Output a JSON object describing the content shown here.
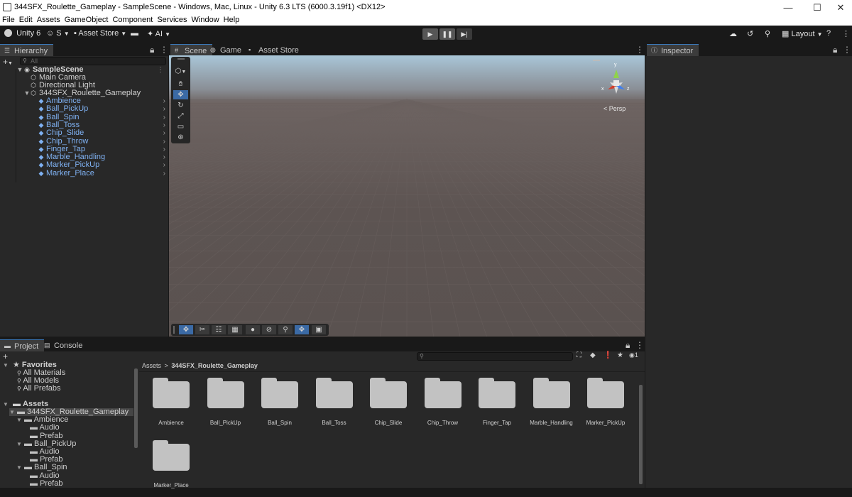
{
  "window": {
    "title": "344SFX_Roulette_Gameplay - SampleScene - Windows, Mac, Linux - Unity 6.3 LTS (6000.3.19f1) <DX12>",
    "minimize": "—",
    "maximize": "☐",
    "close": "✕"
  },
  "menu": [
    "File",
    "Edit",
    "Assets",
    "GameObject",
    "Component",
    "Services",
    "Window",
    "Help"
  ],
  "toolbar": {
    "unity": "Unity 6",
    "account": "S",
    "asset_store": "Asset Store",
    "ai": "AI",
    "layout": "Layout"
  },
  "hierarchy": {
    "tab": "Hierarchy",
    "search_placeholder": "All",
    "scene": "SampleScene",
    "items": [
      {
        "label": "Main Camera"
      },
      {
        "label": "Directional Light"
      },
      {
        "label": "344SFX_Roulette_Gameplay"
      }
    ],
    "prefabs": [
      "Ambience",
      "Ball_PickUp",
      "Ball_Spin",
      "Ball_Toss",
      "Chip_Slide",
      "Chip_Throw",
      "Finger_Tap",
      "Marble_Handling",
      "Marker_PickUp",
      "Marker_Place"
    ]
  },
  "scene_tabs": {
    "scene": "Scene",
    "game": "Game",
    "asset_store": "Asset Store"
  },
  "scene": {
    "persp": "< Persp",
    "gizmo_y": "y",
    "gizmo_x": "x",
    "gizmo_z": "z"
  },
  "inspector": {
    "tab": "Inspector"
  },
  "project": {
    "tab_project": "Project",
    "tab_console": "Console",
    "breadcrumb_root": "Assets",
    "breadcrumb_sep": ">",
    "breadcrumb_current": "344SFX_Roulette_Gameplay",
    "hidden_count": "1",
    "favorites": "Favorites",
    "favorite_items": [
      "All Materials",
      "All Models",
      "All Prefabs"
    ],
    "assets": "Assets",
    "tree": [
      {
        "label": "344SFX_Roulette_Gameplay",
        "depth": 1
      },
      {
        "label": "Ambience",
        "depth": 2
      },
      {
        "label": "Audio",
        "depth": 3
      },
      {
        "label": "Prefab",
        "depth": 3
      },
      {
        "label": "Ball_PickUp",
        "depth": 2
      },
      {
        "label": "Audio",
        "depth": 3
      },
      {
        "label": "Prefab",
        "depth": 3
      },
      {
        "label": "Ball_Spin",
        "depth": 2
      },
      {
        "label": "Audio",
        "depth": 3
      },
      {
        "label": "Prefab",
        "depth": 3
      }
    ],
    "folders": [
      "Ambience",
      "Ball_PickUp",
      "Ball_Spin",
      "Ball_Toss",
      "Chip_Slide",
      "Chip_Throw",
      "Finger_Tap",
      "Marble_Handling",
      "Marker_PickUp",
      "Marker_Place"
    ]
  }
}
